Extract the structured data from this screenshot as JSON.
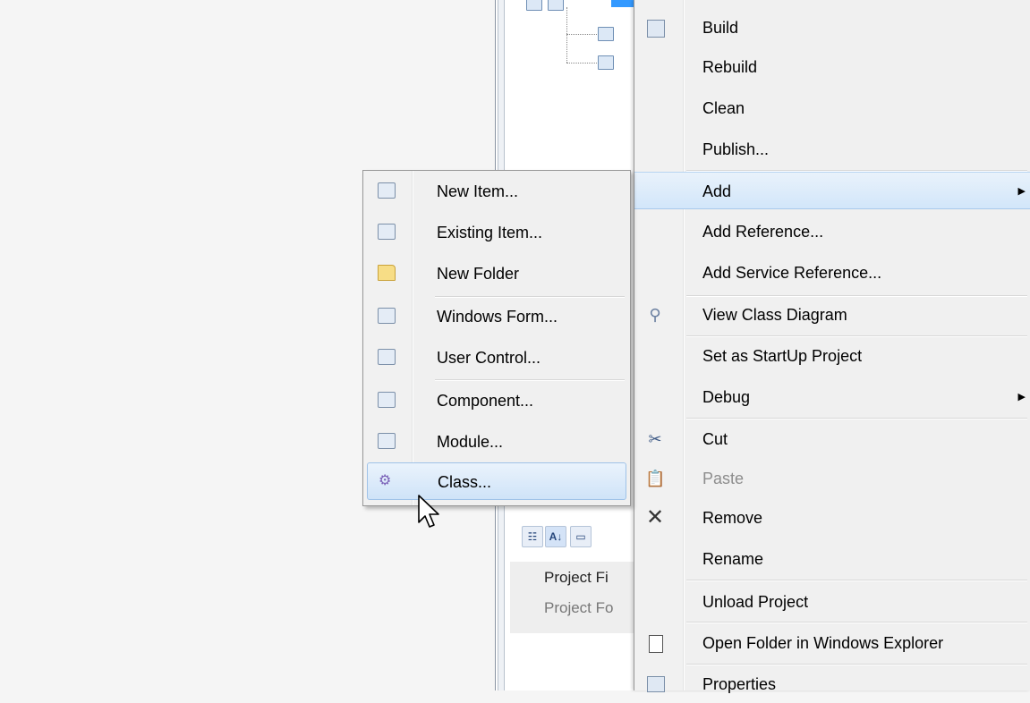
{
  "properties_panel": {
    "rows": [
      "Project Fi",
      "Project Fo"
    ]
  },
  "context_menu": {
    "items": [
      {
        "label": "Build",
        "icon": "build-icon"
      },
      {
        "label": "Rebuild"
      },
      {
        "label": "Clean"
      },
      {
        "label": "Publish..."
      },
      {
        "label": "Add",
        "submenu_arrow": "▶"
      },
      {
        "label": "Add Reference..."
      },
      {
        "label": "Add Service Reference..."
      },
      {
        "label": "View Class Diagram",
        "icon": "class-diagram-icon"
      },
      {
        "label": "Set as StartUp Project"
      },
      {
        "label": "Debug",
        "submenu_arrow": "▶"
      },
      {
        "label": "Cut",
        "icon": "scissors-icon"
      },
      {
        "label": "Paste",
        "icon": "paste-icon",
        "disabled": true
      },
      {
        "label": "Remove",
        "icon": "delete-x-icon"
      },
      {
        "label": "Rename"
      },
      {
        "label": "Unload Project"
      },
      {
        "label": "Open Folder in Windows Explorer",
        "icon": "open-folder-icon"
      },
      {
        "label": "Properties",
        "icon": "properties-icon"
      }
    ]
  },
  "add_submenu": {
    "items": [
      {
        "label": "New Item...",
        "icon": "new-item-icon"
      },
      {
        "label": "Existing Item...",
        "icon": "existing-item-icon"
      },
      {
        "label": "New Folder",
        "icon": "new-folder-icon"
      },
      {
        "label": "Windows Form...",
        "icon": "windows-form-icon"
      },
      {
        "label": "User Control...",
        "icon": "user-control-icon"
      },
      {
        "label": "Component...",
        "icon": "component-icon"
      },
      {
        "label": "Module...",
        "icon": "module-icon"
      },
      {
        "label": "Class...",
        "icon": "class-icon"
      }
    ]
  },
  "colors": {
    "menu_background": "#f0f0f0",
    "highlight": "#d2e6fa",
    "selection": "#3399ff"
  }
}
